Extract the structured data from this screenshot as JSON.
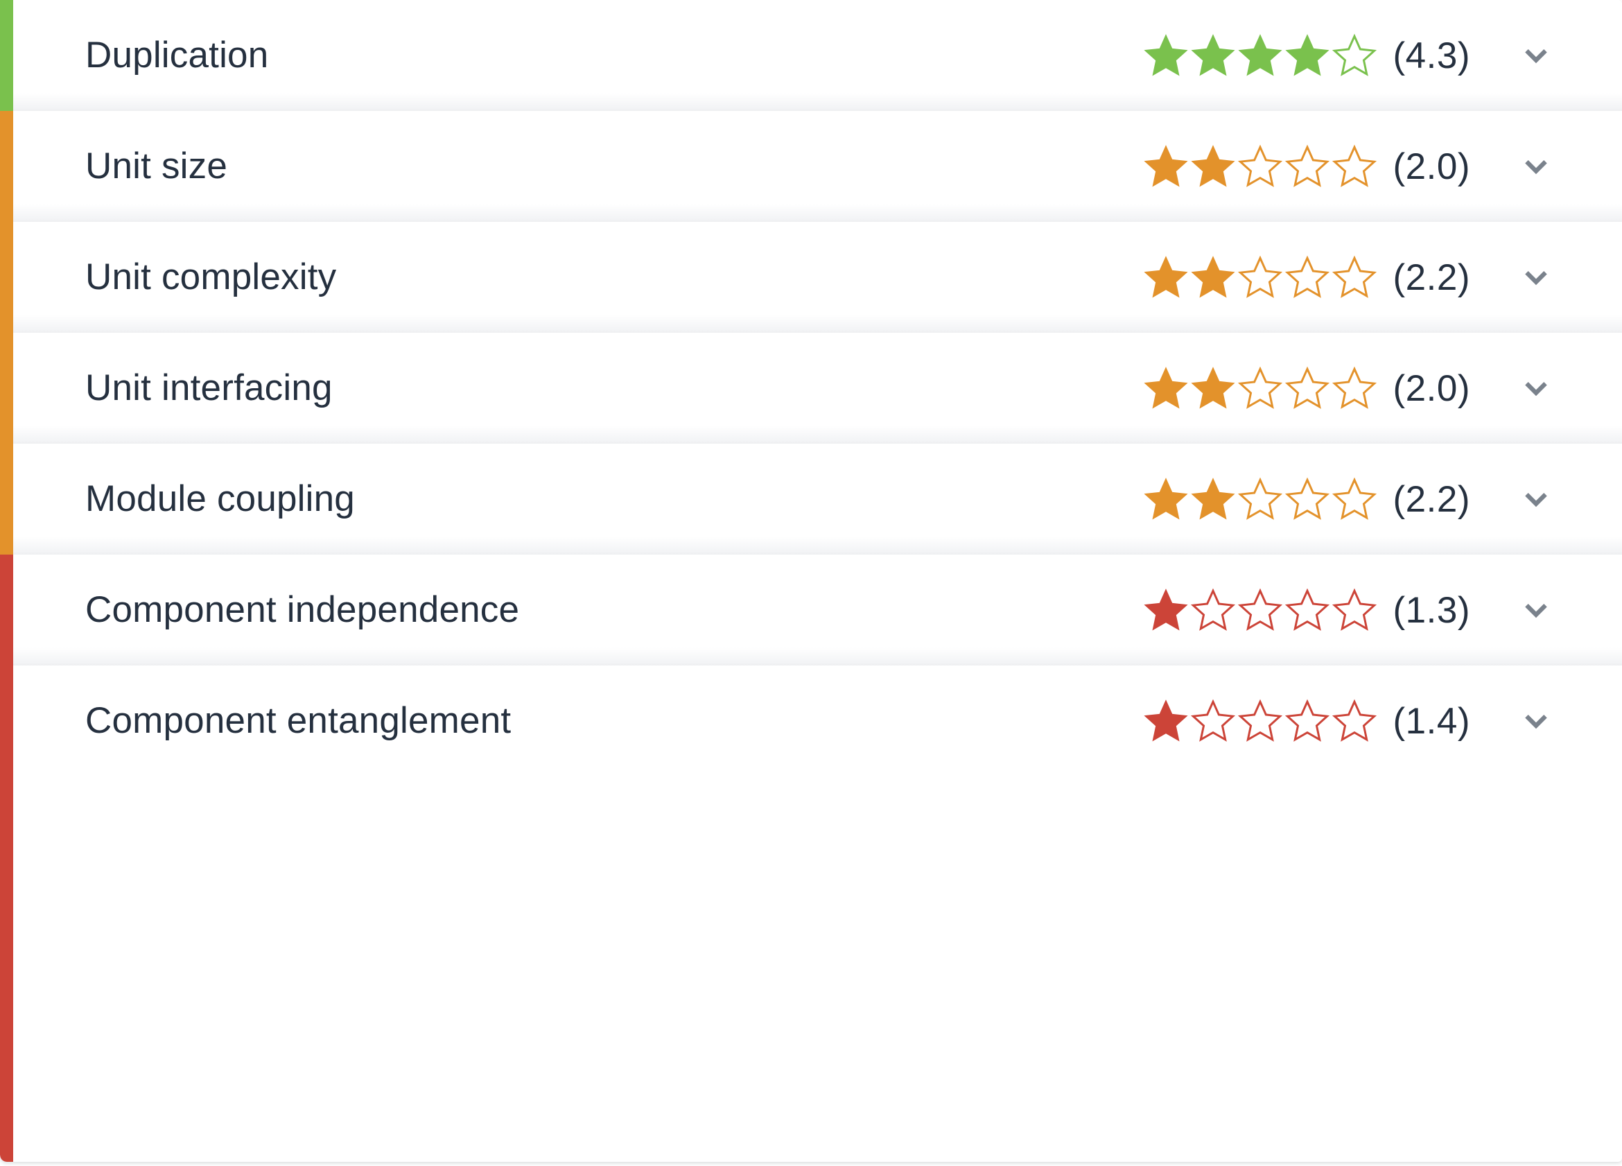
{
  "card": {
    "expand_icon": "chevron-down-icon",
    "chevron_color": "#7a828c",
    "star_max": 5,
    "rating_colors": {
      "green": "#7ac14d",
      "orange": "#e3922b",
      "red": "#cc4438"
    },
    "text_color": "#25303f"
  },
  "rows": [
    {
      "label": "Duplication",
      "score_text": "(4.3)",
      "score": 4.3,
      "filled_stars": 4,
      "half_stars": 0,
      "empty_stars": 1,
      "color": "#7ac14d",
      "rail_color": "#7ac14d",
      "expand_label": "chevron-down-icon"
    },
    {
      "label": "Unit size",
      "score_text": "(2.0)",
      "score": 2.0,
      "filled_stars": 2,
      "half_stars": 0,
      "empty_stars": 3,
      "color": "#e3922b",
      "rail_color": "#e3922b",
      "expand_label": "chevron-down-icon"
    },
    {
      "label": "Unit complexity",
      "score_text": "(2.2)",
      "score": 2.2,
      "filled_stars": 2,
      "half_stars": 0,
      "empty_stars": 3,
      "color": "#e3922b",
      "rail_color": "#e3922b",
      "expand_label": "chevron-down-icon"
    },
    {
      "label": "Unit interfacing",
      "score_text": "(2.0)",
      "score": 2.0,
      "filled_stars": 2,
      "half_stars": 0,
      "empty_stars": 3,
      "color": "#e3922b",
      "rail_color": "#e3922b",
      "expand_label": "chevron-down-icon"
    },
    {
      "label": "Module coupling",
      "score_text": "(2.2)",
      "score": 2.2,
      "filled_stars": 2,
      "half_stars": 0,
      "empty_stars": 3,
      "color": "#e3922b",
      "rail_color": "#e3922b",
      "expand_label": "chevron-down-icon"
    },
    {
      "label": "Component independence",
      "score_text": "(1.3)",
      "score": 1.3,
      "filled_stars": 1,
      "half_stars": 0,
      "empty_stars": 4,
      "color": "#cc4438",
      "rail_color": "#cc4438",
      "expand_label": "chevron-down-icon"
    },
    {
      "label": "Component entanglement",
      "score_text": "(1.4)",
      "score": 1.4,
      "filled_stars": 1,
      "half_stars": 0,
      "empty_stars": 4,
      "color": "#cc4438",
      "rail_color": "#cc4438",
      "expand_label": "chevron-down-icon"
    }
  ]
}
